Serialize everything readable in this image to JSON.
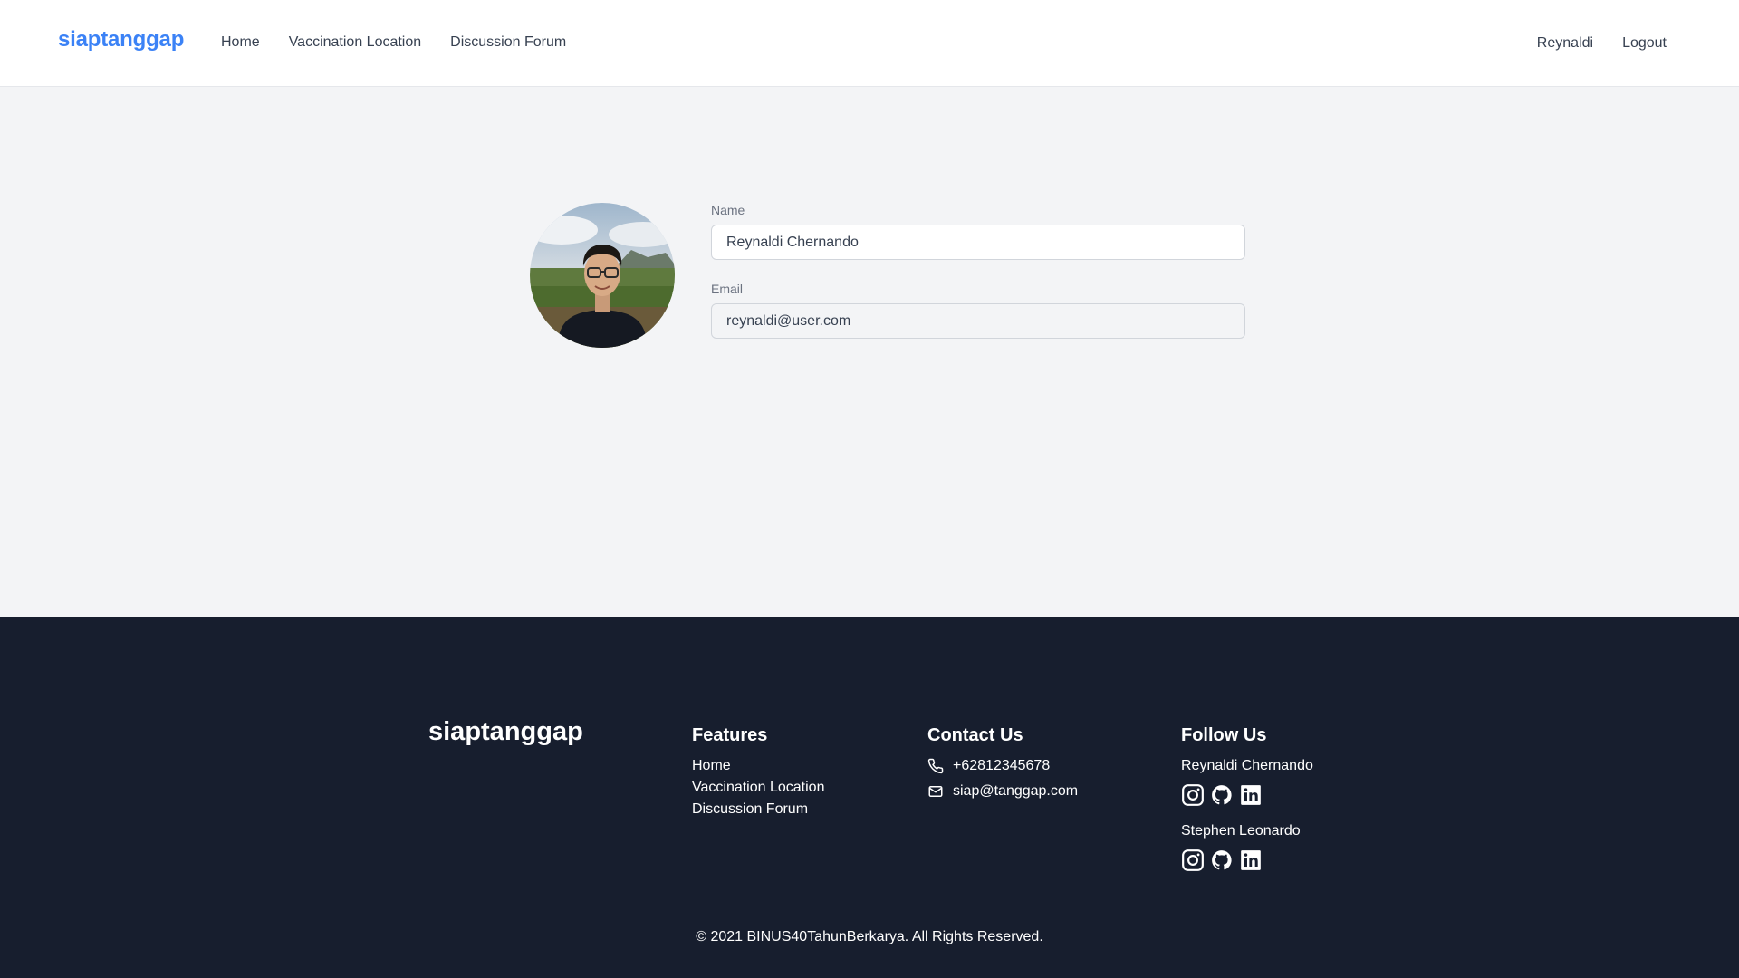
{
  "navbar": {
    "brand": "siaptanggap",
    "links": [
      "Home",
      "Vaccination Location",
      "Discussion Forum"
    ],
    "user_name": "Reynaldi",
    "logout_label": "Logout"
  },
  "profile": {
    "name_label": "Name",
    "name_value": "Reynaldi Chernando",
    "email_label": "Email",
    "email_value": "reynaldi@user.com"
  },
  "footer": {
    "brand": "siaptanggap",
    "features": {
      "title": "Features",
      "links": [
        "Home",
        "Vaccination Location",
        "Discussion Forum"
      ]
    },
    "contact": {
      "title": "Contact Us",
      "phone": "+62812345678",
      "email": "siap@tanggap.com"
    },
    "follow": {
      "title": "Follow Us",
      "people": [
        {
          "name": "Reynaldi Chernando",
          "icons": [
            "instagram-icon",
            "github-icon",
            "linkedin-icon"
          ]
        },
        {
          "name": "Stephen Leonardo",
          "icons": [
            "instagram-icon",
            "github-icon",
            "linkedin-icon"
          ]
        }
      ]
    },
    "copyright": "© 2021 BINUS40TahunBerkarya. All Rights Reserved."
  },
  "colors": {
    "brand_blue": "#3b82f6",
    "footer_bg": "#171e2e",
    "page_bg": "#f3f4f6"
  }
}
